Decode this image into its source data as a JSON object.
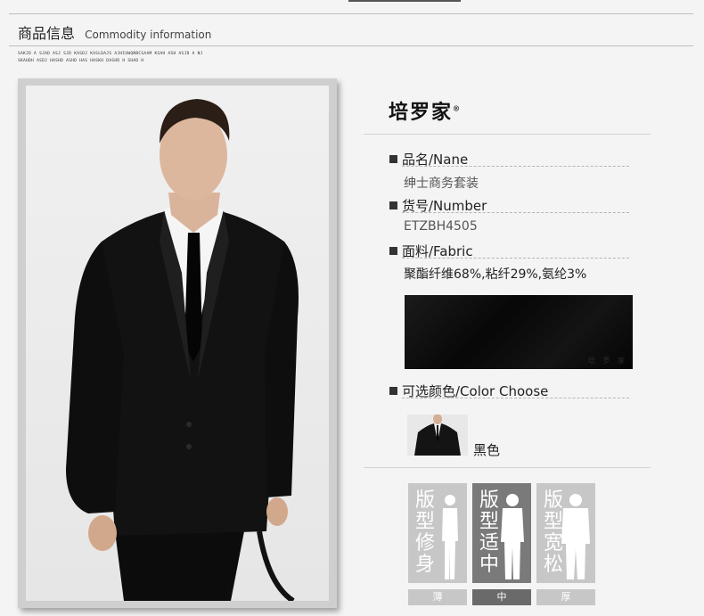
{
  "header": {
    "title_cn": "商品信息",
    "title_en": "Commodity information",
    "fine_line_1": "SAKJD A SJAD ASJ  SJD KASDJ KASLDAJS AJHIUWQNBCSAAM  KSAH ASH ASJD A NJ",
    "fine_line_2": "SKAHDH ASDJ HASHD ASHD HAS HASKH DASHD H  SHAD  H"
  },
  "brand": {
    "name": "培罗家",
    "mark": "®"
  },
  "specs": {
    "name_label": "品名/Nane",
    "name_value": "绅士商务套装",
    "number_label": "货号/Number",
    "number_value": "ETZBH4505",
    "fabric_label": "面料/Fabric",
    "fabric_value": "聚酯纤维68%,粘纤29%,氨纶3%",
    "color_label": "可选颜色/Color Choose",
    "color_value": "黑色"
  },
  "fabric_sample": {
    "watermark": "培 罗 家"
  },
  "fit": [
    {
      "text": "版型修身",
      "tab": "薄",
      "active": false
    },
    {
      "text": "版型适中",
      "tab": "中",
      "active": true
    },
    {
      "text": "版型宽松",
      "tab": "厚",
      "active": false
    }
  ],
  "colors": {
    "suit": "#111111",
    "shirt": "#ffffff",
    "background": "#f4f4f4",
    "fit_active": "#6a6a6a",
    "fit_inactive": "#c7c7c7"
  }
}
